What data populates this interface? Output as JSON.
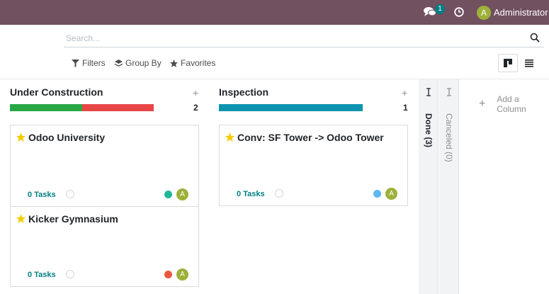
{
  "navbar": {
    "message_count": "1",
    "user_initial": "A",
    "user_name": "Administrator"
  },
  "search": {
    "placeholder": "Search..."
  },
  "control_panel": {
    "filters_label": "Filters",
    "groupby_label": "Group By",
    "favorites_label": "Favorites",
    "active_view": "kanban"
  },
  "columns": [
    {
      "title": "Under Construction",
      "count": "2",
      "progress": [
        {
          "color": "#28a745",
          "fraction": 0.5
        },
        {
          "color": "#e84646",
          "fraction": 0.5
        }
      ],
      "cards": [
        {
          "title": "Odoo University",
          "task_count": "0",
          "task_label": "Tasks",
          "status_color": "#21b799",
          "avatar": "A"
        },
        {
          "title": "Kicker Gymnasium",
          "task_count": "0",
          "task_label": "Tasks",
          "status_color": "#e9573f",
          "avatar": "A"
        }
      ]
    },
    {
      "title": "Inspection",
      "count": "1",
      "progress": [
        {
          "color": "#0d93b0",
          "fraction": 1.0
        }
      ],
      "cards": [
        {
          "title": "Conv: SF Tower -> Odoo Tower",
          "task_count": "0",
          "task_label": "Tasks",
          "status_color": "#5eb7f0",
          "avatar": "A"
        }
      ]
    }
  ],
  "folded_columns": [
    {
      "label": "Done (3)",
      "color": "#212529"
    },
    {
      "label": "Canceled (0)",
      "color": "#8f8f8f"
    }
  ],
  "add_column_label": "Add a Column",
  "colors": {
    "navbar": "#71505f",
    "accent": "#017e84",
    "star": "#f3cc00"
  }
}
